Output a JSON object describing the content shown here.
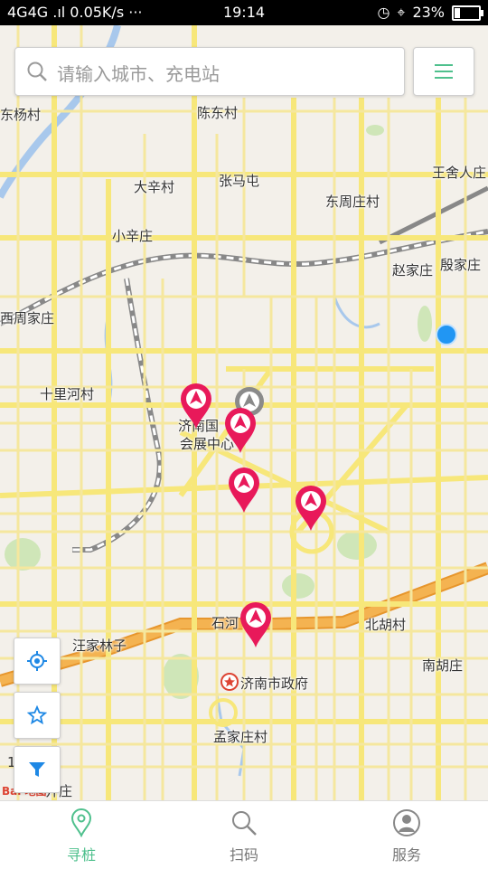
{
  "status_bar": {
    "left": "4G4G .ıl 0.05K/s ···",
    "time": "19:14",
    "battery": "23%",
    "battery_level": 0.23
  },
  "search": {
    "placeholder": "请输入城市、充电站"
  },
  "map": {
    "labels": [
      "东杨村",
      "陈东村",
      "王舍人庄",
      "大辛村",
      "张马屯",
      "东周庄村",
      "小辛庄",
      "赵家庄",
      "殷家庄",
      "西周家庄",
      "十里河村",
      "济南国",
      "会展中心",
      "石河",
      "北胡村",
      "汪家林子",
      "南胡庄",
      "济南市政府",
      "孟家庄村",
      "井庄"
    ],
    "scale_fragment": "1",
    "logo": "Bai 地图"
  },
  "tabs": [
    {
      "label": "寻桩",
      "icon": "location-pin-icon",
      "active": true
    },
    {
      "label": "扫码",
      "icon": "search-icon",
      "active": false
    },
    {
      "label": "服务",
      "icon": "user-icon",
      "active": false
    }
  ],
  "colors": {
    "accent": "#4fc08d",
    "marker": "#e8195a",
    "road": "#f7e77a",
    "highway": "#f2a23a"
  }
}
